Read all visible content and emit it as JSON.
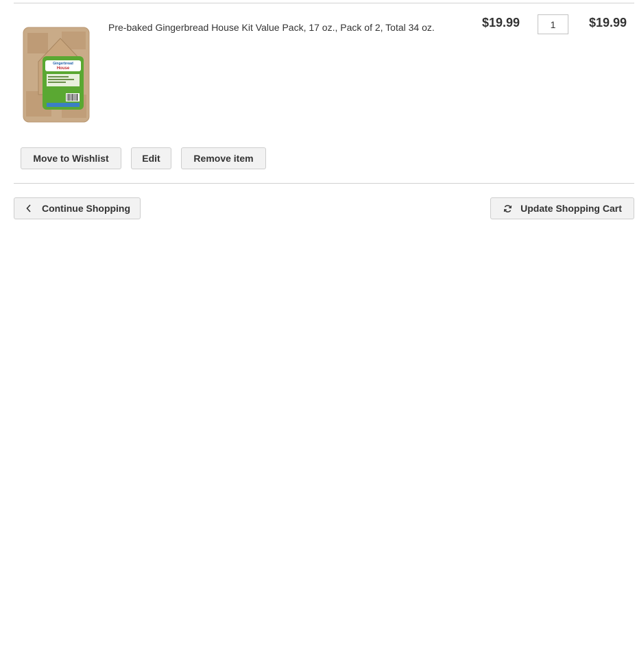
{
  "cart_item": {
    "name": "Pre-baked Gingerbread House Kit Value Pack, 17 oz., Pack of 2, Total 34 oz.",
    "unit_price": "$19.99",
    "quantity": "1",
    "subtotal": "$19.99",
    "image_icon": "gingerbread-house-kit-package"
  },
  "item_actions": {
    "move_to_wishlist_label": "Move to Wishlist",
    "edit_label": "Edit",
    "remove_label": "Remove item"
  },
  "cart_actions": {
    "continue_label": "Continue Shopping",
    "continue_icon": "chevron-left-icon",
    "update_label": "Update Shopping Cart",
    "update_icon": "refresh-icon"
  },
  "colors": {
    "divider": "#d1d1d1",
    "button_bg": "#f2f2f2",
    "button_border": "#cdcdcd",
    "text": "#333333"
  }
}
